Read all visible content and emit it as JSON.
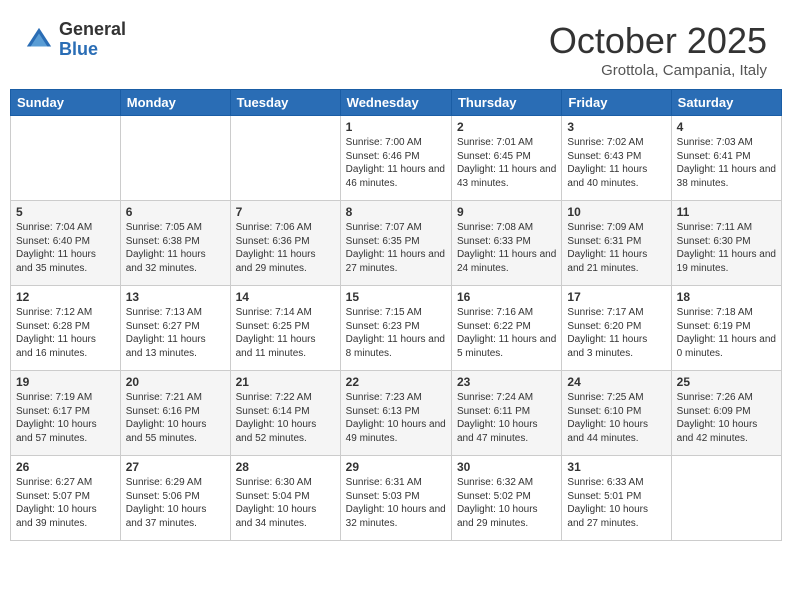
{
  "header": {
    "logo_general": "General",
    "logo_blue": "Blue",
    "month": "October 2025",
    "location": "Grottola, Campania, Italy"
  },
  "days_of_week": [
    "Sunday",
    "Monday",
    "Tuesday",
    "Wednesday",
    "Thursday",
    "Friday",
    "Saturday"
  ],
  "weeks": [
    [
      {
        "day": "",
        "content": ""
      },
      {
        "day": "",
        "content": ""
      },
      {
        "day": "",
        "content": ""
      },
      {
        "day": "1",
        "content": "Sunrise: 7:00 AM\nSunset: 6:46 PM\nDaylight: 11 hours\nand 46 minutes."
      },
      {
        "day": "2",
        "content": "Sunrise: 7:01 AM\nSunset: 6:45 PM\nDaylight: 11 hours\nand 43 minutes."
      },
      {
        "day": "3",
        "content": "Sunrise: 7:02 AM\nSunset: 6:43 PM\nDaylight: 11 hours\nand 40 minutes."
      },
      {
        "day": "4",
        "content": "Sunrise: 7:03 AM\nSunset: 6:41 PM\nDaylight: 11 hours\nand 38 minutes."
      }
    ],
    [
      {
        "day": "5",
        "content": "Sunrise: 7:04 AM\nSunset: 6:40 PM\nDaylight: 11 hours\nand 35 minutes."
      },
      {
        "day": "6",
        "content": "Sunrise: 7:05 AM\nSunset: 6:38 PM\nDaylight: 11 hours\nand 32 minutes."
      },
      {
        "day": "7",
        "content": "Sunrise: 7:06 AM\nSunset: 6:36 PM\nDaylight: 11 hours\nand 29 minutes."
      },
      {
        "day": "8",
        "content": "Sunrise: 7:07 AM\nSunset: 6:35 PM\nDaylight: 11 hours\nand 27 minutes."
      },
      {
        "day": "9",
        "content": "Sunrise: 7:08 AM\nSunset: 6:33 PM\nDaylight: 11 hours\nand 24 minutes."
      },
      {
        "day": "10",
        "content": "Sunrise: 7:09 AM\nSunset: 6:31 PM\nDaylight: 11 hours\nand 21 minutes."
      },
      {
        "day": "11",
        "content": "Sunrise: 7:11 AM\nSunset: 6:30 PM\nDaylight: 11 hours\nand 19 minutes."
      }
    ],
    [
      {
        "day": "12",
        "content": "Sunrise: 7:12 AM\nSunset: 6:28 PM\nDaylight: 11 hours\nand 16 minutes."
      },
      {
        "day": "13",
        "content": "Sunrise: 7:13 AM\nSunset: 6:27 PM\nDaylight: 11 hours\nand 13 minutes."
      },
      {
        "day": "14",
        "content": "Sunrise: 7:14 AM\nSunset: 6:25 PM\nDaylight: 11 hours\nand 11 minutes."
      },
      {
        "day": "15",
        "content": "Sunrise: 7:15 AM\nSunset: 6:23 PM\nDaylight: 11 hours\nand 8 minutes."
      },
      {
        "day": "16",
        "content": "Sunrise: 7:16 AM\nSunset: 6:22 PM\nDaylight: 11 hours\nand 5 minutes."
      },
      {
        "day": "17",
        "content": "Sunrise: 7:17 AM\nSunset: 6:20 PM\nDaylight: 11 hours\nand 3 minutes."
      },
      {
        "day": "18",
        "content": "Sunrise: 7:18 AM\nSunset: 6:19 PM\nDaylight: 11 hours\nand 0 minutes."
      }
    ],
    [
      {
        "day": "19",
        "content": "Sunrise: 7:19 AM\nSunset: 6:17 PM\nDaylight: 10 hours\nand 57 minutes."
      },
      {
        "day": "20",
        "content": "Sunrise: 7:21 AM\nSunset: 6:16 PM\nDaylight: 10 hours\nand 55 minutes."
      },
      {
        "day": "21",
        "content": "Sunrise: 7:22 AM\nSunset: 6:14 PM\nDaylight: 10 hours\nand 52 minutes."
      },
      {
        "day": "22",
        "content": "Sunrise: 7:23 AM\nSunset: 6:13 PM\nDaylight: 10 hours\nand 49 minutes."
      },
      {
        "day": "23",
        "content": "Sunrise: 7:24 AM\nSunset: 6:11 PM\nDaylight: 10 hours\nand 47 minutes."
      },
      {
        "day": "24",
        "content": "Sunrise: 7:25 AM\nSunset: 6:10 PM\nDaylight: 10 hours\nand 44 minutes."
      },
      {
        "day": "25",
        "content": "Sunrise: 7:26 AM\nSunset: 6:09 PM\nDaylight: 10 hours\nand 42 minutes."
      }
    ],
    [
      {
        "day": "26",
        "content": "Sunrise: 6:27 AM\nSunset: 5:07 PM\nDaylight: 10 hours\nand 39 minutes."
      },
      {
        "day": "27",
        "content": "Sunrise: 6:29 AM\nSunset: 5:06 PM\nDaylight: 10 hours\nand 37 minutes."
      },
      {
        "day": "28",
        "content": "Sunrise: 6:30 AM\nSunset: 5:04 PM\nDaylight: 10 hours\nand 34 minutes."
      },
      {
        "day": "29",
        "content": "Sunrise: 6:31 AM\nSunset: 5:03 PM\nDaylight: 10 hours\nand 32 minutes."
      },
      {
        "day": "30",
        "content": "Sunrise: 6:32 AM\nSunset: 5:02 PM\nDaylight: 10 hours\nand 29 minutes."
      },
      {
        "day": "31",
        "content": "Sunrise: 6:33 AM\nSunset: 5:01 PM\nDaylight: 10 hours\nand 27 minutes."
      },
      {
        "day": "",
        "content": ""
      }
    ]
  ]
}
